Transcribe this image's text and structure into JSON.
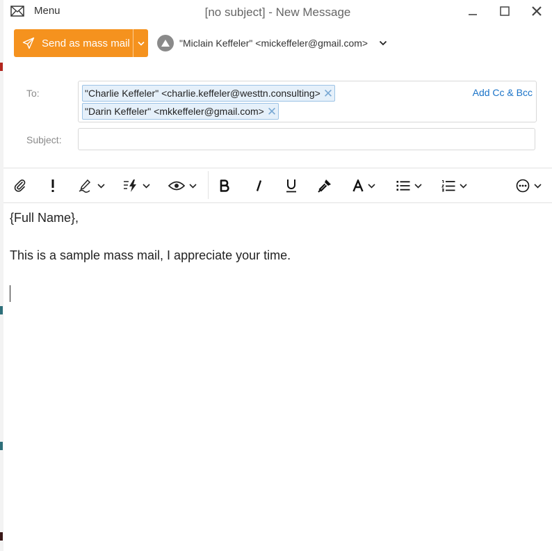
{
  "window": {
    "title": "[no subject] - New Message",
    "menu_label": "Menu"
  },
  "send": {
    "label": "Send as mass mail",
    "accent": "#f5921e"
  },
  "from": {
    "value": "\"Miclain Keffeler\" <mickeffeler@gmail.com>"
  },
  "to": {
    "label": "To:",
    "recipients": [
      "\"Charlie Keffeler\" <charlie.keffeler@westtn.consulting>",
      "\"Darin Keffeler\" <mkkeffeler@gmail.com>"
    ],
    "add_cc_bcc": "Add Cc & Bcc"
  },
  "subject": {
    "label": "Subject:",
    "value": ""
  },
  "toolbar": {
    "icons": [
      "paperclip-icon",
      "importance-icon",
      "signature-icon",
      "quick-text-icon",
      "preview-icon",
      "bold-icon",
      "italic-icon",
      "underline-icon",
      "format-painter-icon",
      "font-icon",
      "bullet-list-icon",
      "numbered-list-icon",
      "more-icon"
    ]
  },
  "body": {
    "lines": [
      "{Full Name},",
      "This is a sample mass mail, I appreciate your time."
    ]
  },
  "colors": {
    "link": "#1a73c8",
    "chip_bg": "#e5f0fa"
  }
}
